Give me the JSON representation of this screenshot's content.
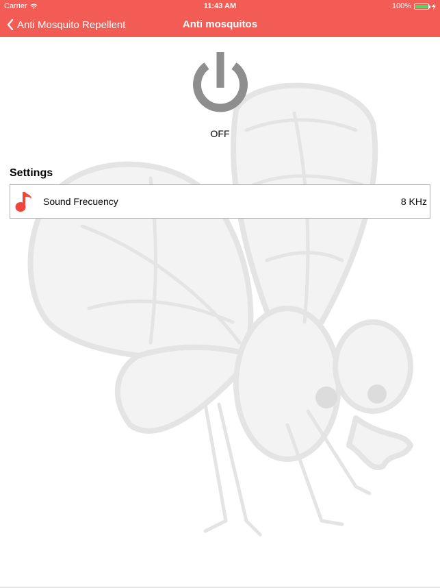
{
  "status": {
    "carrier": "Carrier",
    "time": "11:43 AM",
    "battery": "100%"
  },
  "nav": {
    "back_label": "Anti Mosquito Repellent",
    "title": "Anti mosquitos"
  },
  "power": {
    "state": "OFF"
  },
  "settings": {
    "title": "Settings",
    "items": [
      {
        "label": "Sound Frecuency",
        "value": "8 KHz",
        "icon": "music-note-icon"
      }
    ]
  },
  "colors": {
    "accent": "#f25c54",
    "power_icon": "#8e8e8e",
    "illustration": "#e6e6e6"
  }
}
